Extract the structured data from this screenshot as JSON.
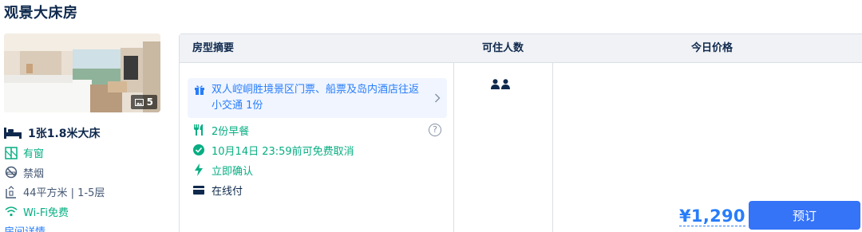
{
  "room": {
    "title": "观景大床房",
    "photo_count": "5",
    "attributes": {
      "bed": "1张1.8米大床",
      "window": "有窗",
      "smoking": "禁烟",
      "size": "44平方米 | 1-5层",
      "wifi": "Wi-Fi免费",
      "more": "房间详情"
    }
  },
  "table": {
    "headers": {
      "summary": "房型摘要",
      "guests": "可住人数",
      "price": "今日价格"
    }
  },
  "offer": {
    "package": "双人崆峒胜境景区门票、船票及岛内酒店往返小交通 1份",
    "breakfast": "2份早餐",
    "cancellation": "10月14日 23:59前可免费取消",
    "confirm": "立即确认",
    "payment": "在线付",
    "guest_count": 2,
    "price": "¥1,290",
    "book_label": "预订"
  },
  "colors": {
    "primary": "#287dfa",
    "button": "#3573f7",
    "green": "#06ae82",
    "text": "#0f294d",
    "border": "#dadfe6"
  }
}
